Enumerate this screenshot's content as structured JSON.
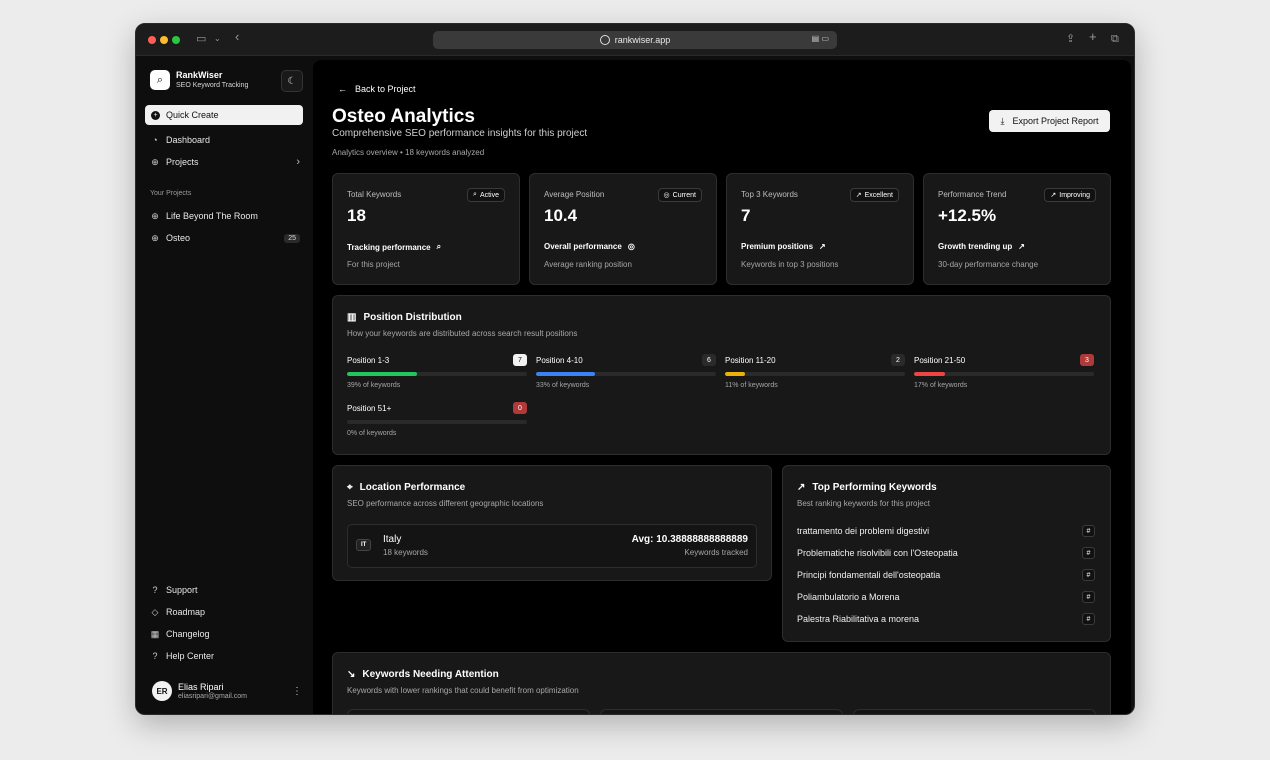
{
  "browser": {
    "url": "rankwiser.app"
  },
  "sidebar": {
    "brand_name": "RankWiser",
    "brand_sub": "SEO Keyword Tracking",
    "quick_create": "Quick Create",
    "nav": [
      {
        "label": "Dashboard",
        "icon": "dashboard-icon"
      },
      {
        "label": "Projects",
        "icon": "globe-icon"
      }
    ],
    "projects_label": "Your Projects",
    "projects": [
      {
        "label": "Life Beyond The Room",
        "count": ""
      },
      {
        "label": "Osteo",
        "count": "25"
      }
    ],
    "footer_nav": [
      {
        "label": "Support",
        "icon": "help-circle-icon"
      },
      {
        "label": "Roadmap",
        "icon": "roadmap-icon"
      },
      {
        "label": "Changelog",
        "icon": "changelog-icon"
      },
      {
        "label": "Help Center",
        "icon": "question-icon"
      }
    ],
    "user": {
      "initials": "ER",
      "name": "Elias Ripari",
      "email": "eliasripari@gmail.com"
    }
  },
  "header": {
    "back": "Back to Project",
    "title": "Osteo Analytics",
    "subtitle": "Comprehensive SEO performance insights for this project",
    "meta": "Analytics overview • 18 keywords analyzed",
    "export": "Export Project Report"
  },
  "stats": [
    {
      "label": "Total Keywords",
      "badge": "Active",
      "badge_icon": "search-icon",
      "value": "18",
      "foot": "Tracking performance",
      "foot_icon": "search-icon",
      "foot_sub": "For this project"
    },
    {
      "label": "Average Position",
      "badge": "Current",
      "badge_icon": "target-icon",
      "value": "10.4",
      "foot": "Overall performance",
      "foot_icon": "target-icon",
      "foot_sub": "Average ranking position"
    },
    {
      "label": "Top 3 Keywords",
      "badge": "Excellent",
      "badge_icon": "trend-up-icon",
      "value": "7",
      "foot": "Premium positions",
      "foot_icon": "trend-up-icon",
      "foot_sub": "Keywords in top 3 positions"
    },
    {
      "label": "Performance Trend",
      "badge": "Improving",
      "badge_icon": "trend-up-icon",
      "value": "+12.5%",
      "foot": "Growth trending up",
      "foot_icon": "trend-up-icon",
      "foot_sub": "30-day performance change"
    }
  ],
  "distribution": {
    "title": "Position Distribution",
    "subtitle": "How your keywords are distributed across search result positions",
    "items": [
      {
        "label": "Position 1-3",
        "count": "7",
        "pct_label": "39% of keywords",
        "fraction": 0.39,
        "color": "#22c55e",
        "badge_bg": "#f2f2f2",
        "badge_fg": "#111111"
      },
      {
        "label": "Position 4-10",
        "count": "6",
        "pct_label": "33% of keywords",
        "fraction": 0.33,
        "color": "#3b82f6",
        "badge_bg": "#2a2a2a",
        "badge_fg": "#ffffff"
      },
      {
        "label": "Position 11-20",
        "count": "2",
        "pct_label": "11% of keywords",
        "fraction": 0.11,
        "color": "#eab308",
        "badge_bg": "#2a2a2a",
        "badge_fg": "#ffffff"
      },
      {
        "label": "Position 21-50",
        "count": "3",
        "pct_label": "17% of keywords",
        "fraction": 0.17,
        "color": "#ef4444",
        "badge_bg": "#b03a3a",
        "badge_fg": "#ffffff"
      },
      {
        "label": "Position 51+",
        "count": "0",
        "pct_label": "0% of keywords",
        "fraction": 0,
        "color": "#6b7280",
        "badge_bg": "#b03a3a",
        "badge_fg": "#ffffff"
      }
    ]
  },
  "location": {
    "title": "Location Performance",
    "subtitle": "SEO performance across different geographic locations",
    "code": "IT",
    "name": "Italy",
    "keywords": "18 keywords",
    "avg": "Avg: 10.38888888888889",
    "avg_sub": "Keywords tracked"
  },
  "top_keywords": {
    "title": "Top Performing Keywords",
    "subtitle": "Best ranking keywords for this project",
    "items": [
      "trattamento dei problemi digestivi",
      "Problematiche risolvibili con l'Osteopatia",
      "Principi fondamentali dell'osteopatia",
      "Poliambulatorio a Morena",
      "Palestra Riabilitativa a morena"
    ],
    "hash": "#"
  },
  "attention": {
    "title": "Keywords Needing Attention",
    "subtitle": "Keywords with lower rankings that could benefit from optimization"
  }
}
